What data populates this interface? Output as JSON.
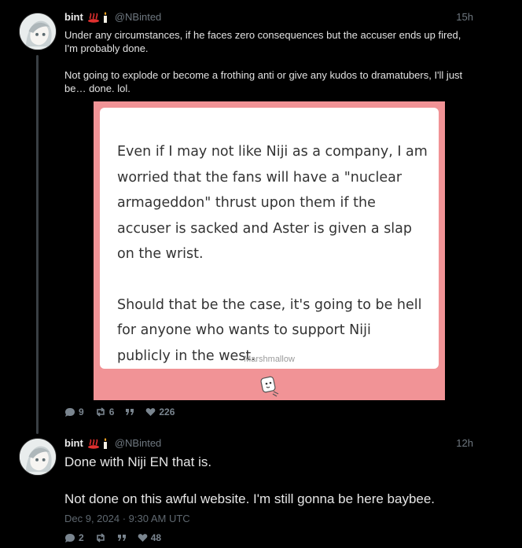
{
  "posts": [
    {
      "author": "bint",
      "handle": "@NBinted",
      "time": "15h",
      "body": [
        "Under any circumstances, if he faces zero consequences but the accuser ends up fired, I'm probably done.",
        "Not going to explode or become a frothing anti or give any kudos to dramatubers, I'll just be… done. lol."
      ],
      "embed": {
        "paragraphs": [
          "Even if I may not like Niji as a company, I am worried that the fans will have a \"nuclear armageddon\" thrust upon them if the accuser is sacked and Aster is given a slap on the wrist.",
          "Should that be the case, it's going to be hell for anyone who wants to support Niji publicly in the west."
        ],
        "footer": "Marshmallow",
        "background": "#f19396"
      },
      "stats": {
        "replies": "9",
        "reposts": "6",
        "likes": "226"
      }
    },
    {
      "author": "bint",
      "handle": "@NBinted",
      "time": "12h",
      "body": [
        "Done with Niji EN that is.",
        "Not done on this awful website. I'm still gonna be here baybee."
      ],
      "date": "Dec 9, 2024 · 9:30 AM UTC",
      "stats": {
        "replies": "2",
        "reposts": "",
        "likes": "48"
      }
    }
  ],
  "icons": {
    "reply": "comment-bubble-icon",
    "repost": "repost-arrows-icon",
    "quote": "quote-marks-icon",
    "like": "heart-icon",
    "flair": [
      "hot-springs-icon",
      "candle-icon"
    ]
  },
  "colors": {
    "background": "#000000",
    "muted": "#6f7880",
    "embed_bg": "#f19396"
  }
}
